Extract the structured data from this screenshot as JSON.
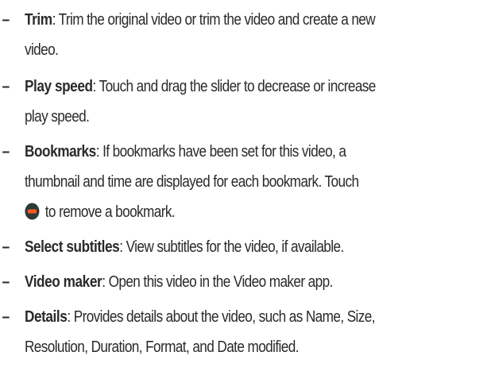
{
  "items": [
    {
      "term": "Trim",
      "lines": [
        ": Trim the original video or trim the video and create a new",
        "video."
      ]
    },
    {
      "term": "Play speed",
      "lines": [
        ": Touch and drag the slider to decrease or increase",
        "play speed."
      ]
    },
    {
      "term": "Bookmarks",
      "lines": [
        ": If bookmarks have been set for this video, a",
        "thumbnail and time are displayed for each bookmark. Touch",
        "to remove a bookmark."
      ],
      "icon": "remove-bookmark-icon"
    },
    {
      "term": "Select subtitles",
      "lines": [
        ": View subtitles for the video, if available."
      ]
    },
    {
      "term": "Video maker",
      "lines": [
        ": Open this video in the Video maker app."
      ]
    },
    {
      "term": "Details",
      "lines": [
        ": Provides details about the video, such as Name, Size,",
        "Resolution, Duration, Format, and Date modified."
      ]
    }
  ],
  "dash": "–",
  "colors": {
    "text": "#2a2a2a",
    "icon_fill": "#2e3a3a",
    "icon_bar": "#ff5a1f"
  }
}
